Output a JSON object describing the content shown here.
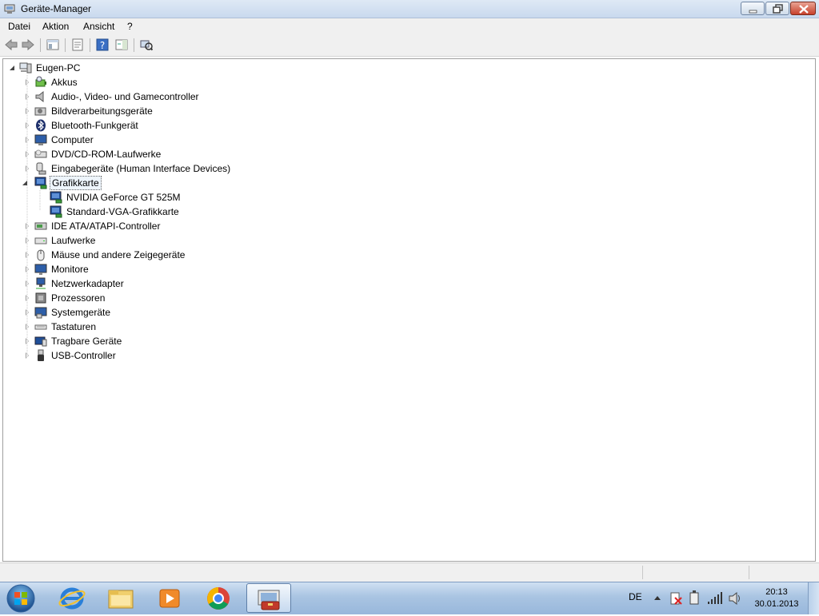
{
  "window": {
    "title": "Geräte-Manager"
  },
  "menu": [
    "Datei",
    "Aktion",
    "Ansicht",
    "?"
  ],
  "toolbar": {
    "buttons": [
      "back-icon",
      "forward-icon",
      "console-tree-icon",
      "properties-icon",
      "help-icon",
      "action-pane-icon",
      "scan-hardware-icon"
    ]
  },
  "tree": {
    "root": "Eugen-PC",
    "categories": [
      {
        "label": "Akkus",
        "icon": "battery-icon"
      },
      {
        "label": "Audio-, Video- und Gamecontroller",
        "icon": "speaker-icon"
      },
      {
        "label": "Bildverarbeitungsgeräte",
        "icon": "camera-icon"
      },
      {
        "label": "Bluetooth-Funkgerät",
        "icon": "bluetooth-icon"
      },
      {
        "label": "Computer",
        "icon": "computer-icon"
      },
      {
        "label": "DVD/CD-ROM-Laufwerke",
        "icon": "dvd-drive-icon"
      },
      {
        "label": "Eingabegeräte (Human Interface Devices)",
        "icon": "hid-icon"
      },
      {
        "label": "Grafikkarte",
        "icon": "display-adapter-icon",
        "expanded": true,
        "selected": true,
        "children": [
          "NVIDIA GeForce GT 525M",
          "Standard-VGA-Grafikkarte"
        ]
      },
      {
        "label": "IDE ATA/ATAPI-Controller",
        "icon": "ide-controller-icon"
      },
      {
        "label": "Laufwerke",
        "icon": "disk-drive-icon"
      },
      {
        "label": "Mäuse und andere Zeigegeräte",
        "icon": "mouse-icon"
      },
      {
        "label": "Monitore",
        "icon": "monitor-icon"
      },
      {
        "label": "Netzwerkadapter",
        "icon": "network-adapter-icon"
      },
      {
        "label": "Prozessoren",
        "icon": "processor-icon"
      },
      {
        "label": "Systemgeräte",
        "icon": "system-devices-icon"
      },
      {
        "label": "Tastaturen",
        "icon": "keyboard-icon"
      },
      {
        "label": "Tragbare Geräte",
        "icon": "portable-device-icon"
      },
      {
        "label": "USB-Controller",
        "icon": "usb-icon"
      }
    ]
  },
  "taskbar": {
    "apps": [
      "internet-explorer-icon",
      "file-explorer-icon",
      "media-player-icon",
      "chrome-icon",
      "device-manager-icon"
    ],
    "active_app": "device-manager-icon",
    "language": "DE",
    "time": "20:13",
    "date": "30.01.2013"
  },
  "colors": {
    "taskbar": "#a9c4e2",
    "selection": "#eef5fc",
    "close_button": "#c7402a"
  }
}
